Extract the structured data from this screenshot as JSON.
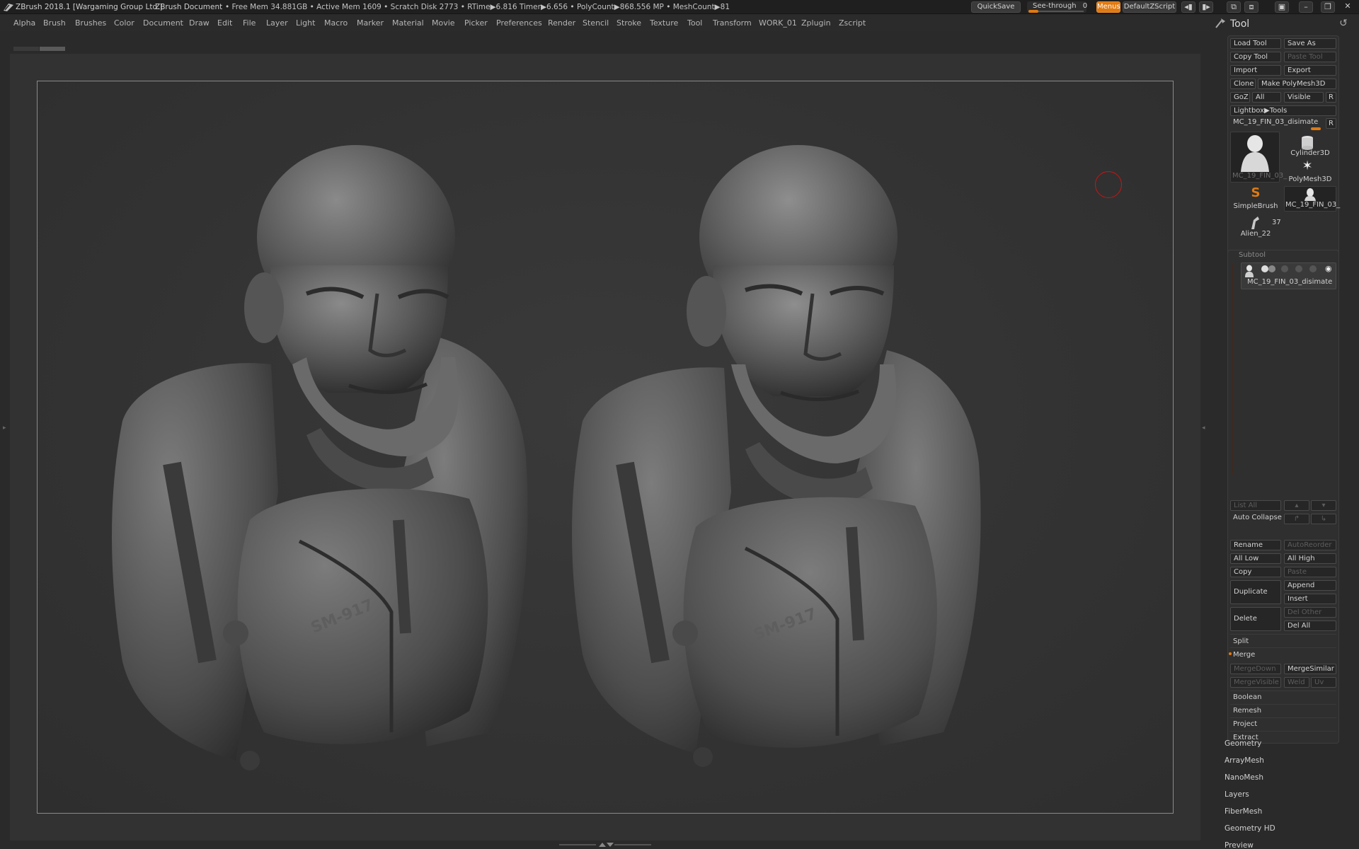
{
  "titlebar": {
    "app_title": "ZBrush 2018.1 [Wargaming Group Ltd.]",
    "doc_title": "ZBrush Document",
    "stats": "• Free Mem 34.881GB • Active Mem 1609 • Scratch Disk 2773 •   RTime▶6.816 Timer▶6.656 • PolyCount▶868.556 MP  • MeshCount▶81",
    "quicksave": "QuickSave",
    "see_through_label": "See-through",
    "see_through_value": "0",
    "see_through_level": 0.0,
    "menus": "Menus",
    "default_zscript": "DefaultZScript"
  },
  "menubar": {
    "items": [
      "Alpha",
      "Brush",
      "Brushes",
      "Color",
      "Document",
      "Draw",
      "Edit",
      "File",
      "Layer",
      "Light",
      "Macro",
      "Marker",
      "Material",
      "Movie",
      "Picker",
      "Preferences",
      "Render",
      "Stencil",
      "Stroke",
      "Texture",
      "Tool",
      "Transform",
      "WORK_01",
      "Zplugin",
      "Zscript"
    ]
  },
  "tool_panel": {
    "title": "Tool",
    "load_tool": "Load Tool",
    "save_as": "Save As",
    "copy_tool": "Copy Tool",
    "paste_tool": "Paste Tool",
    "import": "Import",
    "export": "Export",
    "clone": "Clone",
    "make_polymesh": "Make PolyMesh3D",
    "goz": "GoZ",
    "all": "All",
    "visible": "Visible",
    "r": "R",
    "lightbox_tools": "Lightbox▶Tools",
    "current_tool": "MC_19_FIN_03_disimate",
    "tools": [
      {
        "name": "MC_19_FIN_03_",
        "icon": "bust-thumbnail-icon"
      },
      {
        "name": "Cylinder3D",
        "icon": "cylinder-icon"
      },
      {
        "name": "PolyMesh3D",
        "icon": "star-icon"
      },
      {
        "name": "SimpleBrush",
        "icon": "simplebrush-icon"
      },
      {
        "name": "MC_19_FIN_03_",
        "icon": "bust-small-icon"
      },
      {
        "name": "Alien_22",
        "icon": "alien-icon"
      }
    ],
    "tool_count": "37"
  },
  "subtool": {
    "header": "Subtool",
    "item_name": "MC_19_FIN_03_disimate",
    "list_all": "List All",
    "auto_collapse": "Auto Collapse",
    "rename": "Rename",
    "autoreorder": "AutoReorder",
    "all_low": "All Low",
    "all_high": "All High",
    "copy": "Copy",
    "paste": "Paste",
    "duplicate": "Duplicate",
    "append": "Append",
    "insert": "Insert",
    "delete": "Delete",
    "del_other": "Del Other",
    "del_all": "Del All",
    "split": "Split",
    "merge": "Merge",
    "merge_down": "MergeDown",
    "merge_similar": "MergeSimilar",
    "merge_visible": "MergeVisible",
    "weld": "Weld",
    "uv": "Uv",
    "boolean": "Boolean",
    "remesh": "Remesh",
    "project": "Project",
    "extract": "Extract"
  },
  "subpanels": [
    "Geometry",
    "ArrayMesh",
    "NanoMesh",
    "Layers",
    "FiberMesh",
    "Geometry HD",
    "Preview"
  ],
  "viewport": {
    "bust_left_label": "SM-917",
    "bust_right_label": "SM-917"
  },
  "colors": {
    "accent": "#e07a10",
    "brush_cursor": "#c21818",
    "panel_bg": "#2a2a2a",
    "canvas_bg": "#323232"
  }
}
